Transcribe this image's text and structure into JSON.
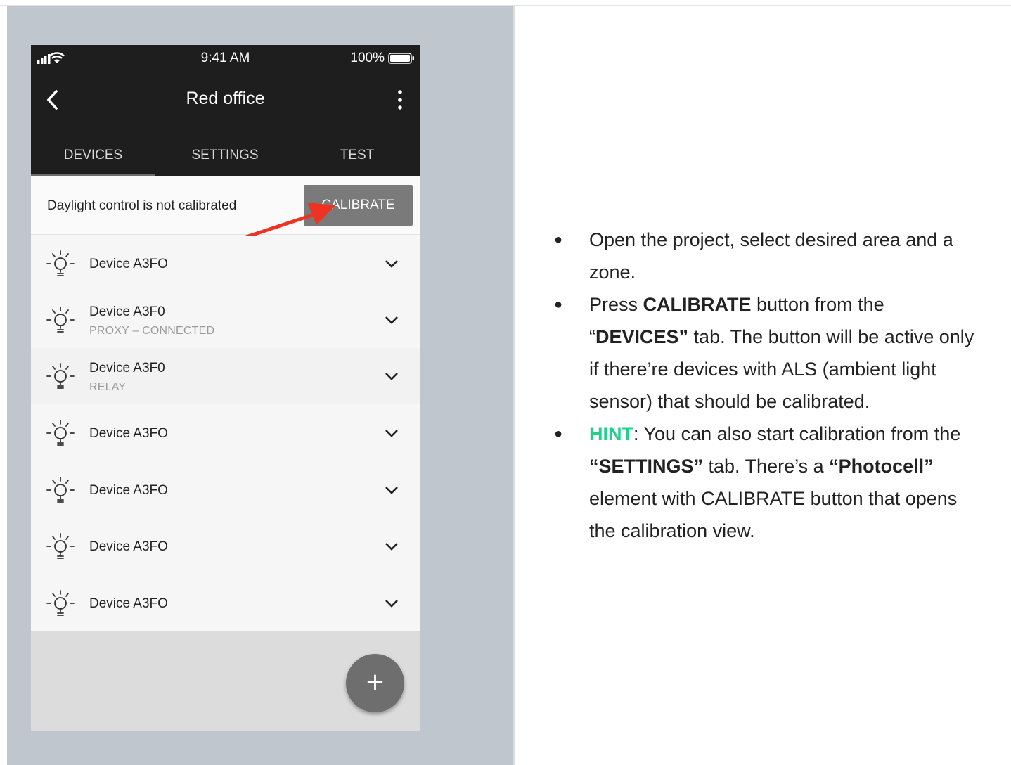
{
  "status_bar": {
    "time": "9:41 AM",
    "battery": "100%"
  },
  "app_bar": {
    "title": "Red office"
  },
  "tabs": [
    {
      "label": "DEVICES",
      "selected": true
    },
    {
      "label": "SETTINGS",
      "selected": false
    },
    {
      "label": "TEST",
      "selected": false
    }
  ],
  "calibration": {
    "message": "Daylight control is not calibrated",
    "button_label": "CALIBRATE"
  },
  "devices": [
    {
      "name": "Device A3FO",
      "subtitle": ""
    },
    {
      "name": "Device A3F0",
      "subtitle": "PROXY – CONNECTED"
    },
    {
      "name": "Device A3F0",
      "subtitle": "RELAY"
    },
    {
      "name": "Device A3FO",
      "subtitle": ""
    },
    {
      "name": "Device A3FO",
      "subtitle": ""
    },
    {
      "name": "Device A3FO",
      "subtitle": ""
    },
    {
      "name": "Device A3FO",
      "subtitle": ""
    }
  ],
  "fab": {
    "symbol": "+"
  },
  "instructions": {
    "b1": "Open the project, select desired area and a zone.",
    "b2_a": "Press ",
    "b2_b": "CALIBRATE",
    "b2_c": " button from the “",
    "b2_d": "DEVICES”",
    "b2_e": " tab. The button will be active only if there’re devices with ALS (ambient light sensor) that should be calibrated.",
    "b3_a": "HINT",
    "b3_b": ": You can also start calibration from the ",
    "b3_c": "“SETTINGS”",
    "b3_d": " tab. There’s a ",
    "b3_e": "“Photocell”",
    "b3_f": " element with CALIBRATE button that opens the calibration view."
  },
  "colors": {
    "app_bar": "#1e1e1e",
    "calibrate_button": "#7a7a7a",
    "arrow": "#ee3322",
    "hint": "#21d08a",
    "panel_background": "#c0c6ce"
  }
}
